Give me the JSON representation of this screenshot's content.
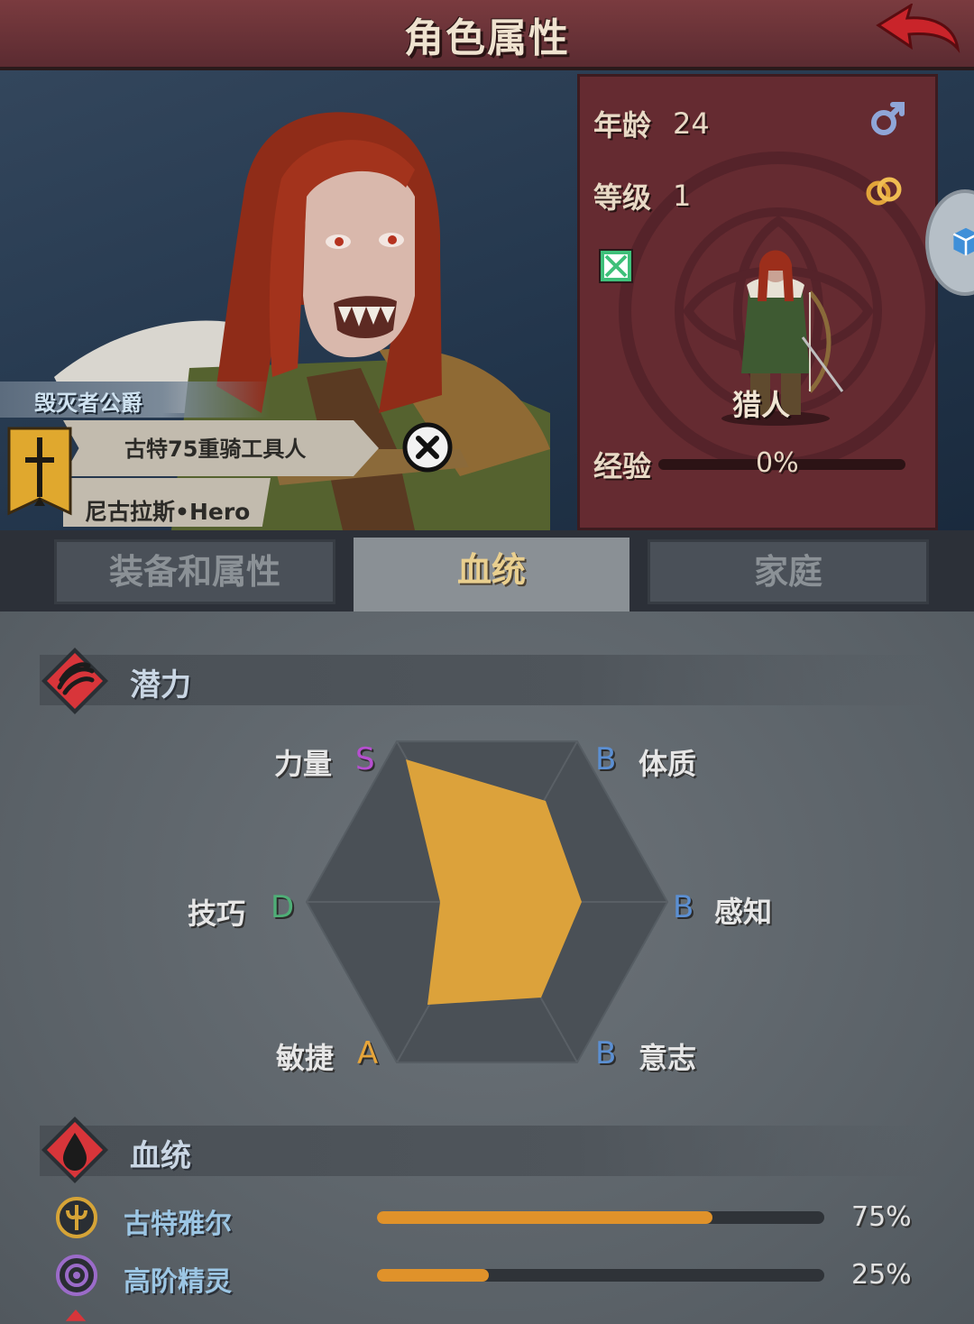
{
  "header": {
    "title": "角色属性"
  },
  "character": {
    "noble_title": "毁灭者公爵",
    "nickname": "古特75重骑工具人",
    "name": "尼古拉斯•Hero"
  },
  "info": {
    "age_label": "年龄",
    "age": "24",
    "level_label": "等级",
    "level": "1",
    "class": "猎人",
    "exp_label": "经验",
    "exp_value": "0%",
    "exp_progress": 0
  },
  "tabs": [
    {
      "label": "装备和属性",
      "active": false
    },
    {
      "label": "血统",
      "active": true
    },
    {
      "label": "家庭",
      "active": false
    }
  ],
  "potential": {
    "title": "潜力",
    "stats": [
      {
        "label": "力量",
        "grade": "S",
        "color": "#b64fd0"
      },
      {
        "label": "体质",
        "grade": "B",
        "color": "#5b8fd2"
      },
      {
        "label": "感知",
        "grade": "B",
        "color": "#5b8fd2"
      },
      {
        "label": "意志",
        "grade": "B",
        "color": "#5b8fd2"
      },
      {
        "label": "敏捷",
        "grade": "A",
        "color": "#e6a53a"
      },
      {
        "label": "技巧",
        "grade": "D",
        "color": "#4fae77"
      }
    ]
  },
  "lineage": {
    "title": "血统",
    "items": [
      {
        "name": "古特雅尔",
        "percent": "75%",
        "value": 0.75,
        "icon_color": "#d6a437"
      },
      {
        "name": "高阶精灵",
        "percent": "25%",
        "value": 0.25,
        "icon_color": "#9b6bc9"
      }
    ]
  },
  "colors": {
    "accent": "#e0a63a",
    "header": "#6b3338",
    "card": "#652b31"
  }
}
